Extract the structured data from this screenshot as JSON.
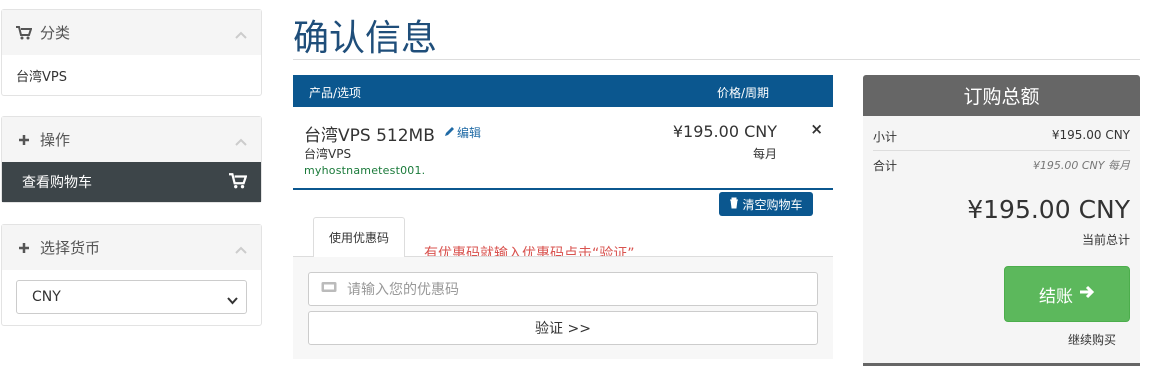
{
  "sidebar": {
    "categories": {
      "title": "分类",
      "items": [
        "台湾VPS"
      ]
    },
    "actions": {
      "title": "操作",
      "items": [
        "查看购物车"
      ]
    },
    "currency": {
      "title": "选择货币",
      "selected": "CNY"
    }
  },
  "main": {
    "title": "确认信息",
    "table_header": {
      "product": "产品/选项",
      "price": "价格/周期"
    },
    "item": {
      "name": "台湾VPS 512MB",
      "edit_label": "编辑",
      "group": "台湾VPS",
      "hostname": "myhostnametest001.",
      "price": "¥195.00 CNY",
      "cycle": "每月",
      "remove": "×"
    },
    "empty_cart_label": "清空购物车",
    "promo": {
      "tab_label": "使用优惠码",
      "note": "有优惠码就输入优惠码点击“验证”",
      "placeholder": "请输入您的优惠码",
      "verify_label": "验证 >>"
    }
  },
  "summary": {
    "title": "订购总额",
    "subtotal_label": "小计",
    "subtotal_value": "¥195.00 CNY",
    "total_label": "合计",
    "total_value": "¥195.00 CNY 每月",
    "grand_total": "¥195.00 CNY",
    "grand_total_label": "当前总计",
    "checkout_label": "结账",
    "continue_label": "继续购买"
  },
  "icons": {
    "cart": "shopping-cart-icon",
    "plus": "plus-icon",
    "chevron": "chevron-up-icon",
    "edit": "pencil-icon",
    "trash": "trash-icon",
    "ticket": "ticket-icon",
    "arrow": "arrow-right-icon"
  },
  "colors": {
    "brand_blue": "#0b578f",
    "title_blue": "#1f4e7a",
    "summary_gray": "#666666",
    "active_dark": "#3d4549",
    "checkout_green": "#5cb85c",
    "promo_red": "#d9534f"
  }
}
